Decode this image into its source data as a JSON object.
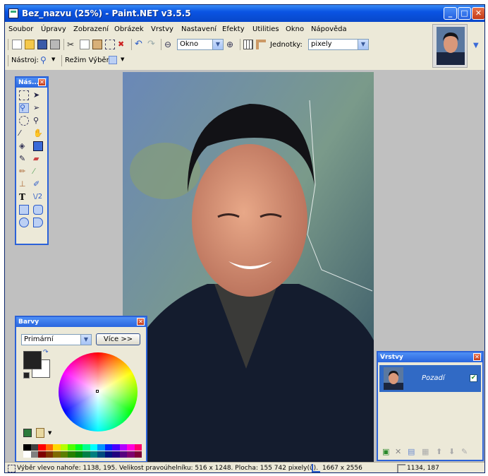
{
  "window": {
    "title": "Bez_nazvu (25%) - Paint.NET v3.5.5",
    "buttons": {
      "minimize": "_",
      "maximize": "□",
      "close": "✕"
    }
  },
  "menu": [
    "Soubor",
    "Úpravy",
    "Zobrazení",
    "Obrázek",
    "Vrstvy",
    "Nastavení",
    "Efekty",
    "Utilities",
    "Okno",
    "Nápověda"
  ],
  "toolbar": {
    "zoom_value": "Okno",
    "units_label": "Jednotky:",
    "units_value": "pixely"
  },
  "toolbar2": {
    "tool_label": "Nástroj:",
    "selection_mode_label": "Režim Výběr:"
  },
  "tools_panel": {
    "title": "Nás..."
  },
  "colors_panel": {
    "title": "Barvy",
    "mode_value": "Primární",
    "more_button": "Více >>",
    "palette": [
      "#000000",
      "#404040",
      "#ff0000",
      "#ff6a00",
      "#ffd800",
      "#b6ff00",
      "#4cff00",
      "#00ff21",
      "#00ff90",
      "#00ffff",
      "#0094ff",
      "#0026ff",
      "#4800ff",
      "#b200ff",
      "#ff00dc",
      "#ff006e"
    ],
    "palette_row2": [
      "#ffffff",
      "#808080",
      "#7f0000",
      "#7f3300",
      "#7f6a00",
      "#5b7f00",
      "#267f00",
      "#007f0e",
      "#007f46",
      "#007f7f",
      "#004a7f",
      "#00137f",
      "#21007f",
      "#57007f",
      "#7f006e",
      "#7f0037"
    ]
  },
  "layers_panel": {
    "title": "Vrstvy",
    "layer_name": "Pozadí"
  },
  "status": {
    "selection_info": "Výběr vlevo nahoře: 1138, 195. Velikost pravoúhelníku: 516 x 1248. Plocha: 155 742 pixely(ů).",
    "image_size": "1667 x 2556",
    "cursor_pos": "1134, 187"
  },
  "colors": {
    "accent": "#2b62d8",
    "titlebar": "#0a54e3",
    "canvas_bg": "#c0c0c0"
  }
}
